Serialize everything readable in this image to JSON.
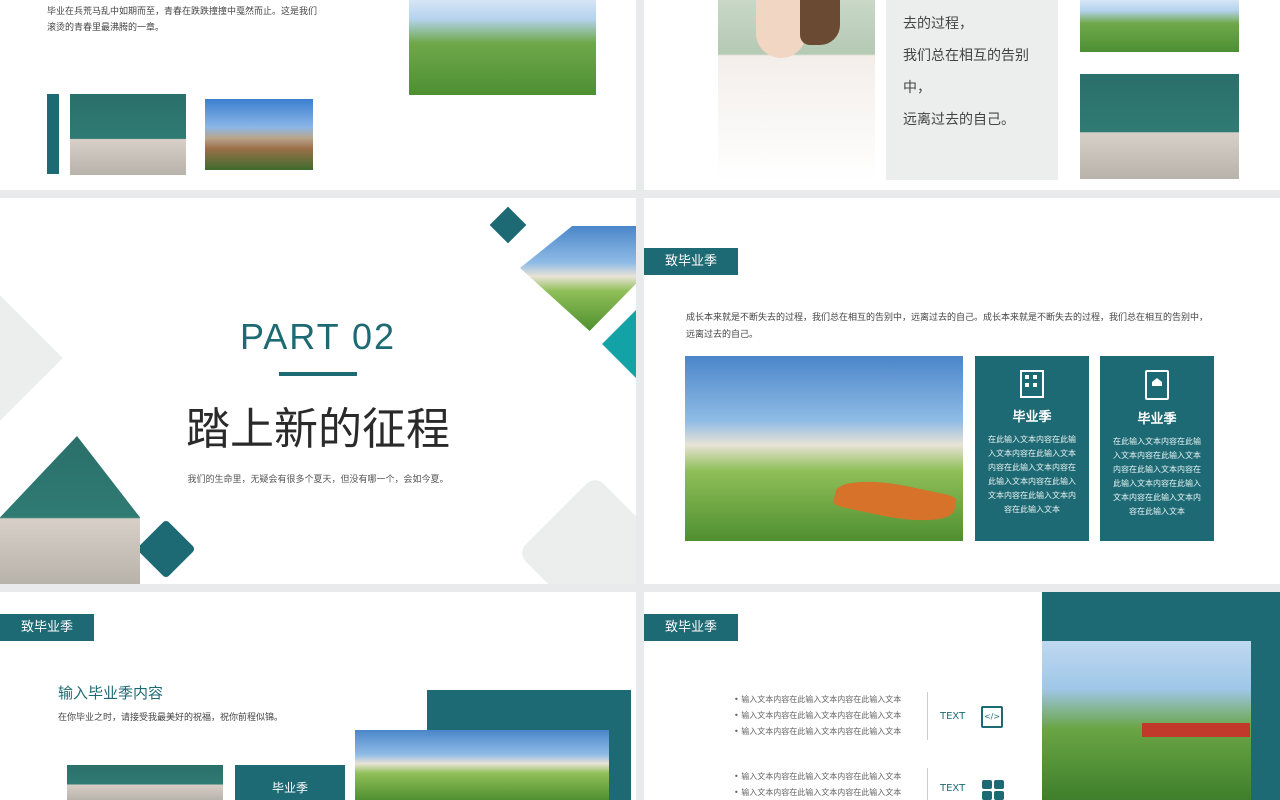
{
  "slide1": {
    "text_line1": "毕业在兵荒马乱中如期而至，青春在跌跌撞撞中戛然而止。这是我们",
    "text_line2": "滚烫的青春里最沸腾的一章。"
  },
  "slide2": {
    "quote": [
      "去的过程，",
      "我们总在相互的告别",
      "中，",
      "远离过去的自己。"
    ]
  },
  "slide3": {
    "part": "PART  02",
    "title": "踏上新的征程",
    "subtitle": "我们的生命里，无疑会有很多个夏天，但没有哪一个，会如今夏。"
  },
  "slide4": {
    "tag": "致毕业季",
    "intro": "成长本来就是不断失去的过程，我们总在相互的告别中，远离过去的自己。成长本来就是不断失去的过程，我们总在相互的告别中，远离过去的自己。",
    "cards": [
      {
        "icon": "building-icon",
        "title": "毕业季",
        "body": "在此输入文本内容在此输入文本内容在此输入文本内容在此输入文本内容在此输入文本内容在此输入文本内容在此输入文本内容在此输入文本"
      },
      {
        "icon": "house-document-icon",
        "title": "毕业季",
        "body": "在此输入文本内容在此输入文本内容在此输入文本内容在此输入文本内容在此输入文本内容在此输入文本内容在此输入文本内容在此输入文本"
      }
    ]
  },
  "slide5": {
    "tag": "致毕业季",
    "heading": "输入毕业季内容",
    "sub": "在你毕业之时，请接受我最美好的祝福，祝你前程似锦。",
    "card_label": "毕业季"
  },
  "slide6": {
    "tag": "致毕业季",
    "group1": [
      "输入文本内容在此输入文本内容在此输入文本",
      "输入文本内容在此输入文本内容在此输入文本",
      "输入文本内容在此输入文本内容在此输入文本"
    ],
    "group2": [
      "输入文本内容在此输入文本内容在此输入文本",
      "输入文本内容在此输入文本内容在此输入文本"
    ],
    "label1": "TEXT",
    "label2": "TEXT"
  },
  "colors": {
    "teal": "#1e6a74",
    "light_teal": "#13a3a6",
    "grey": "#eceded"
  }
}
